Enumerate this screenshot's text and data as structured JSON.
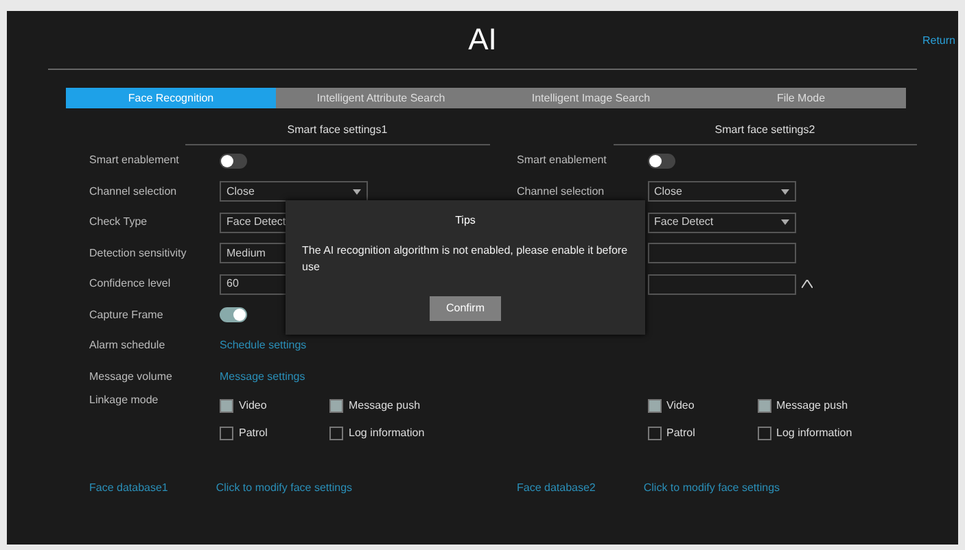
{
  "window": {
    "title": "AI",
    "return_link": "Return"
  },
  "tabs": [
    {
      "label": "Face Recognition",
      "selected": true
    },
    {
      "label": "Intelligent Attribute Search",
      "selected": false
    },
    {
      "label": "Intelligent Image Search",
      "selected": false
    },
    {
      "label": "File Mode",
      "selected": false
    }
  ],
  "panels": [
    {
      "heading": "Smart face settings1",
      "rows": [
        {
          "kind": "toggle",
          "label": "Smart enablement",
          "on": false
        },
        {
          "kind": "select",
          "label": "Channel selection",
          "value": "Close"
        },
        {
          "kind": "select",
          "label": "Check Type",
          "value": "Face Detect"
        },
        {
          "kind": "input",
          "label": "Detection sensitivity",
          "value": "Medium"
        },
        {
          "kind": "input",
          "label": "Confidence level",
          "value": "60"
        },
        {
          "kind": "toggle",
          "label": "Capture Frame",
          "on": true
        },
        {
          "kind": "link",
          "label": "Alarm schedule",
          "value": "Schedule settings"
        },
        {
          "kind": "link",
          "label": "Message volume",
          "value": "Message settings"
        },
        {
          "kind": "checks",
          "label": "Linkage mode",
          "options": [
            {
              "label": "Video",
              "checked": true
            },
            {
              "label": "Message push",
              "checked": true
            },
            {
              "label": "Patrol",
              "checked": false
            },
            {
              "label": "Log information",
              "checked": false
            }
          ]
        }
      ],
      "footer": [
        {
          "label": "Face database1"
        },
        {
          "label": "Click to modify face settings"
        }
      ]
    },
    {
      "heading": "Smart face settings2",
      "rows": [
        {
          "kind": "toggle",
          "label": "Smart enablement",
          "on": false
        },
        {
          "kind": "select",
          "label": "Channel selection",
          "value": "Close"
        },
        {
          "kind": "select",
          "value": "Face Detect"
        },
        {
          "kind": "input"
        },
        {
          "kind": "spin"
        },
        {
          "kind": "blank"
        },
        {
          "kind": "blank"
        },
        {
          "kind": "blank"
        },
        {
          "kind": "checks",
          "options": [
            {
              "label": "Video",
              "checked": true
            },
            {
              "label": "Message push",
              "checked": true
            },
            {
              "label": "Patrol",
              "checked": false
            },
            {
              "label": "Log information",
              "checked": false
            }
          ]
        }
      ],
      "footer": [
        {
          "label": "Face database2"
        },
        {
          "label": "Click to modify face settings"
        }
      ]
    }
  ],
  "dialog": {
    "title": "Tips",
    "message": "The AI recognition algorithm is not enabled, please enable it before use",
    "button": "Confirm"
  }
}
